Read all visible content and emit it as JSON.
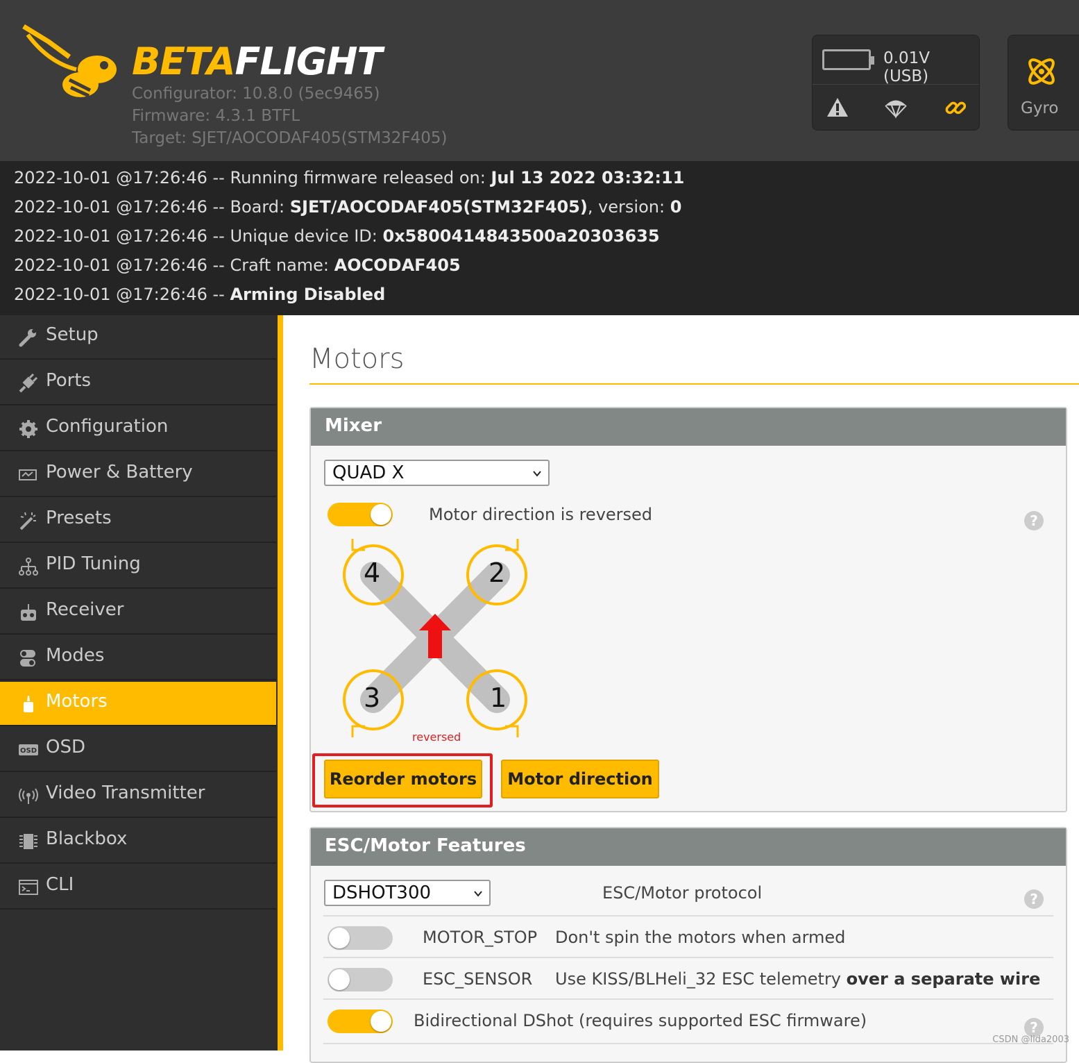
{
  "header": {
    "brand_left": "BETA",
    "brand_right": "FLIGHT",
    "configurator": "Configurator: 10.8.0 (5ec9465)",
    "firmware": "Firmware: 4.3.1 BTFL",
    "target": "Target: SJET/AOCODAF405(STM32F405)",
    "voltage": "0.01V (USB)",
    "gyro_label": "Gyro",
    "status_icons": [
      "warning-icon",
      "parachute-icon",
      "link-icon"
    ],
    "accent_color": "#ffbb00"
  },
  "log": [
    {
      "prefix": "2022-10-01 @17:26:46 -- Running firmware released on: ",
      "bold": "Jul 13 2022 03:32:11",
      "suffix": ""
    },
    {
      "prefix": "2022-10-01 @17:26:46 -- Board: ",
      "bold": "SJET/AOCODAF405(STM32F405)",
      "suffix": ", version: ",
      "bold2": "0"
    },
    {
      "prefix": "2022-10-01 @17:26:46 -- Unique device ID: ",
      "bold": "0x5800414843500a20303635",
      "suffix": ""
    },
    {
      "prefix": "2022-10-01 @17:26:46 -- Craft name: ",
      "bold": "AOCODAF405",
      "suffix": ""
    },
    {
      "prefix": "2022-10-01 @17:26:46 -- ",
      "bold": "Arming Disabled",
      "suffix": ""
    }
  ],
  "sidebar": {
    "items": [
      {
        "label": "Setup",
        "icon": "wrench-icon"
      },
      {
        "label": "Ports",
        "icon": "plug-icon"
      },
      {
        "label": "Configuration",
        "icon": "gear-icon"
      },
      {
        "label": "Power & Battery",
        "icon": "battery-icon"
      },
      {
        "label": "Presets",
        "icon": "wand-icon"
      },
      {
        "label": "PID Tuning",
        "icon": "sliders-icon"
      },
      {
        "label": "Receiver",
        "icon": "remote-icon"
      },
      {
        "label": "Modes",
        "icon": "toggles-icon"
      },
      {
        "label": "Motors",
        "icon": "motor-icon",
        "active": true
      },
      {
        "label": "OSD",
        "icon": "osd-icon"
      },
      {
        "label": "Video Transmitter",
        "icon": "antenna-icon"
      },
      {
        "label": "Blackbox",
        "icon": "blackbox-icon"
      },
      {
        "label": "CLI",
        "icon": "terminal-icon"
      }
    ]
  },
  "main": {
    "title": "Motors",
    "mixer": {
      "heading": "Mixer",
      "selected": "QUAD X",
      "reversed_toggle_on": true,
      "reversed_label": "Motor direction is reversed",
      "motors": [
        "4",
        "2",
        "3",
        "1"
      ],
      "reversed_caption": "reversed",
      "reorder_button": "Reorder motors",
      "direction_button": "Motor direction"
    },
    "esc": {
      "heading": "ESC/Motor Features",
      "protocol_selected": "DSHOT300",
      "protocol_label": "ESC/Motor protocol",
      "motor_stop_name": "MOTOR_STOP",
      "motor_stop_desc": "Don't spin the motors when armed",
      "motor_stop_on": false,
      "esc_sensor_name": "ESC_SENSOR",
      "esc_sensor_desc": "Use KISS/BLHeli_32 ESC telemetry ",
      "esc_sensor_desc_bold": "over a separate wire",
      "esc_sensor_on": false,
      "bidir_label": "Bidirectional DShot (requires supported ESC firmware)",
      "bidir_on": true
    }
  },
  "watermark": "CSDN @lida2003"
}
